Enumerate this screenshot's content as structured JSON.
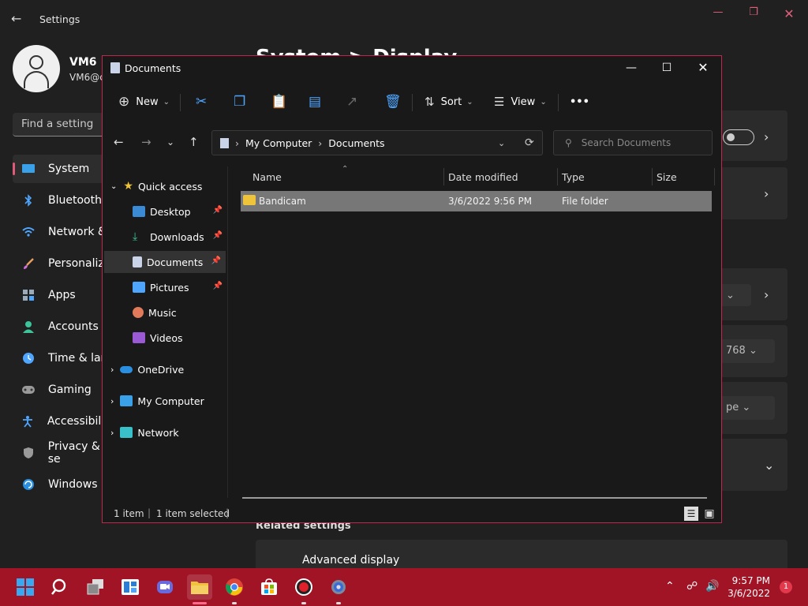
{
  "settings": {
    "title": "Settings",
    "user_name": "VM6",
    "user_email": "VM6@c",
    "find_placeholder": "Find a setting",
    "heading": "System > Display",
    "nav": [
      {
        "label": "System"
      },
      {
        "label": "Bluetooth &"
      },
      {
        "label": "Network &"
      },
      {
        "label": "Personaliza"
      },
      {
        "label": "Apps"
      },
      {
        "label": "Accounts"
      },
      {
        "label": "Time & lang"
      },
      {
        "label": "Gaming"
      },
      {
        "label": "Accessibility"
      },
      {
        "label": "Privacy & se"
      },
      {
        "label": "Windows U"
      }
    ],
    "dropdown_resolution_partial": "768",
    "dropdown_orientation_partial": "pe",
    "related_settings": "Related settings",
    "advanced_display": "Advanced display"
  },
  "explorer": {
    "title": "Documents",
    "toolbar": {
      "new": "New",
      "sort": "Sort",
      "view": "View",
      "more": "•••"
    },
    "breadcrumb": [
      "My Computer",
      "Documents"
    ],
    "search_placeholder": "Search Documents",
    "tree": {
      "quick_access": "Quick access",
      "desktop": "Desktop",
      "downloads": "Downloads",
      "documents": "Documents",
      "pictures": "Pictures",
      "music": "Music",
      "videos": "Videos",
      "onedrive": "OneDrive",
      "my_computer": "My Computer",
      "network": "Network"
    },
    "columns": {
      "name": "Name",
      "date": "Date modified",
      "type": "Type",
      "size": "Size"
    },
    "files": [
      {
        "name": "Bandicam",
        "date": "3/6/2022 9:56 PM",
        "type": "File folder",
        "size": ""
      }
    ],
    "status": {
      "count": "1 item",
      "selected": "1 item selected"
    }
  },
  "taskbar": {
    "time": "9:57 PM",
    "date": "3/6/2022",
    "notifications": "1"
  },
  "colors": {
    "accent": "#c0274e",
    "taskbar": "#a01425",
    "selection_row": "#777777"
  }
}
